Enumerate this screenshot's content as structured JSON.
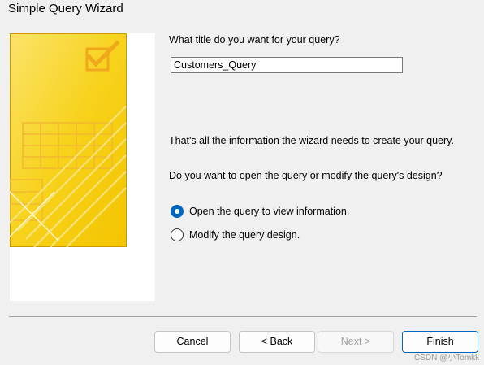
{
  "window": {
    "title": "Simple Query Wizard"
  },
  "prompts": {
    "title_question": "What title do you want for your query?",
    "info": "That's all the information the wizard needs to create your query.",
    "open_question": "Do you want to open the query or modify the query's design?"
  },
  "title_input": {
    "value": "Customers_Query"
  },
  "options": [
    {
      "label": "Open the query to view information.",
      "selected": true
    },
    {
      "label": "Modify the query design.",
      "selected": false
    }
  ],
  "buttons": {
    "cancel": "Cancel",
    "back": "< Back",
    "next": "Next >",
    "finish": "Finish"
  },
  "watermark": "CSDN @小Tomkk",
  "colors": {
    "accent": "#0067c0",
    "illustration_yellow": "#f7d21c",
    "illustration_border": "#c89a00"
  }
}
